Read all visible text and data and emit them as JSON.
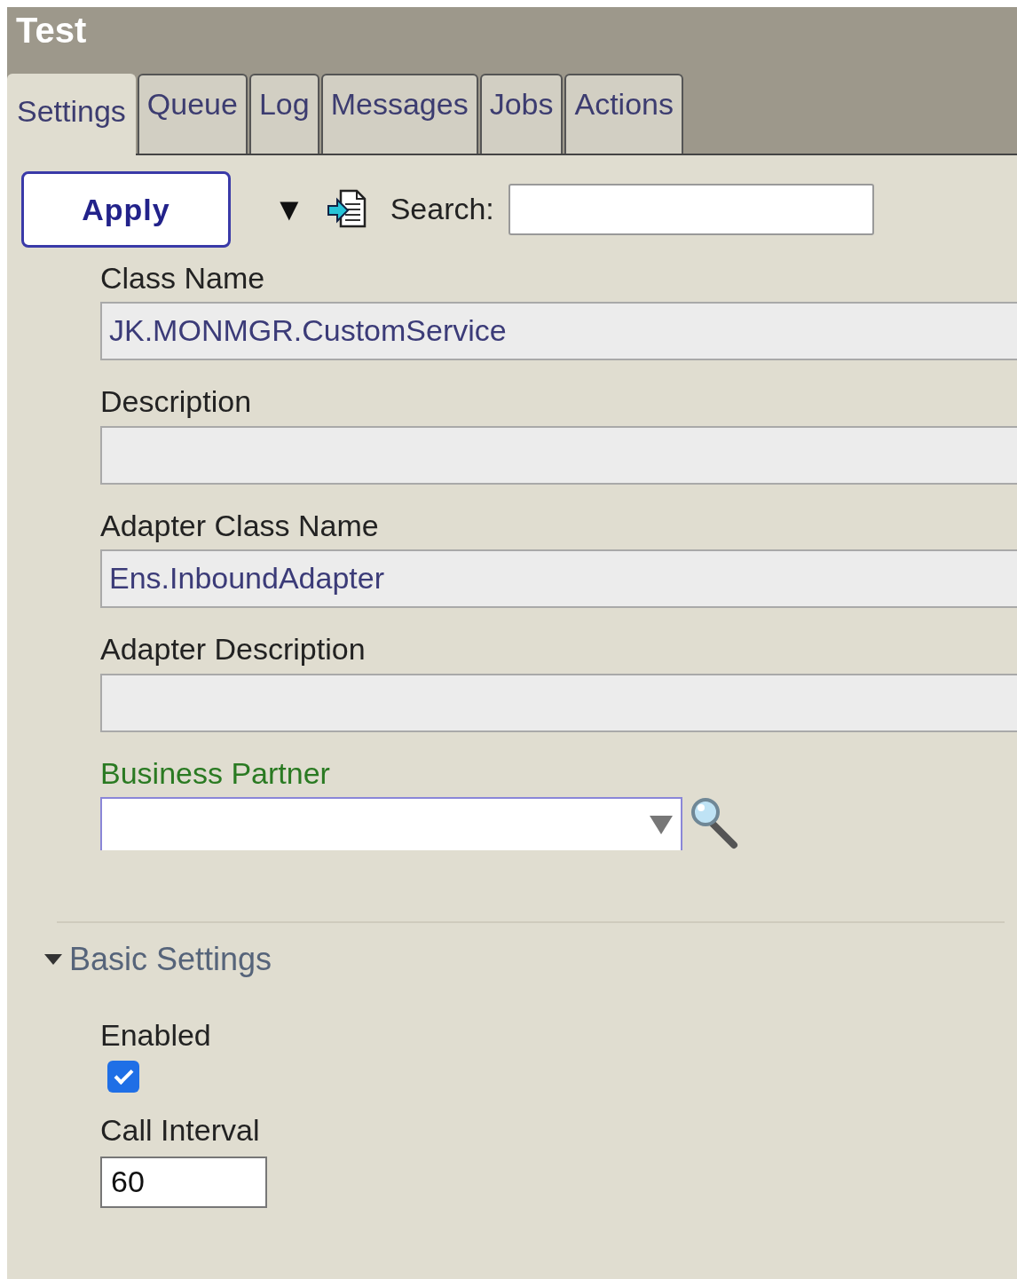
{
  "window": {
    "title": "Test"
  },
  "tabs": [
    {
      "label": "Settings",
      "selected": true
    },
    {
      "label": "Queue",
      "selected": false
    },
    {
      "label": "Log",
      "selected": false
    },
    {
      "label": "Messages",
      "selected": false
    },
    {
      "label": "Jobs",
      "selected": false
    },
    {
      "label": "Actions",
      "selected": false
    }
  ],
  "toolbar": {
    "apply_button": "Apply",
    "menu_caret": "▼",
    "search": {
      "label": "Search:"
    }
  },
  "fields": [
    {
      "kind": "text",
      "label": "Class Name",
      "value": "JK.MONMGR.CustomService"
    },
    {
      "kind": "text",
      "label": "Description"
    },
    {
      "kind": "text",
      "label": "Adapter Class Name",
      "value": "Ens.InboundAdapter"
    },
    {
      "kind": "text",
      "label": "Adapter Description"
    },
    {
      "kind": "combo",
      "label": "Business Partner"
    }
  ],
  "sections": [
    {
      "title": "Basic Settings",
      "expanded": true,
      "settings": [
        {
          "kind": "checkbox",
          "label": "Enabled",
          "checked": true
        },
        {
          "kind": "number",
          "label": "Call Interval",
          "value": "60"
        }
      ]
    }
  ]
}
